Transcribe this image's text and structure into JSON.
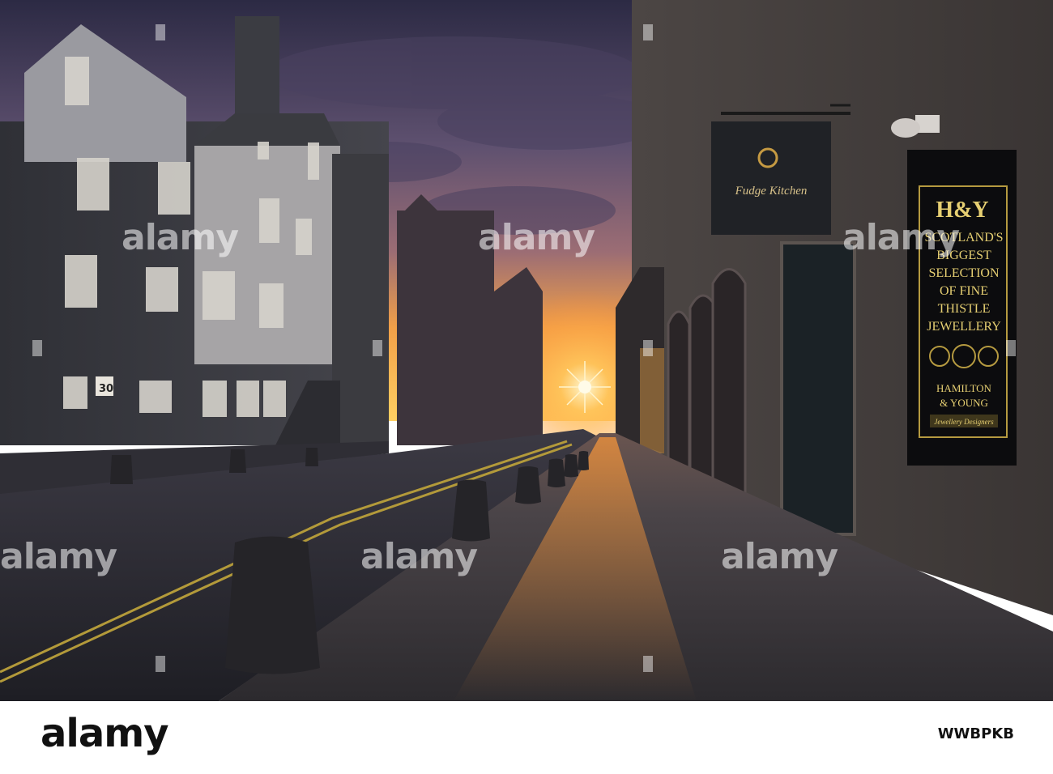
{
  "scene": {
    "sign_shop": {
      "logo_text": "Fudge Kitchen"
    },
    "jewellery_sign": {
      "monogram": "H&Y",
      "lines": [
        "SCOTLAND'S",
        "BIGGEST",
        "SELECTION",
        "OF FINE",
        "THISTLE",
        "JEWELLERY"
      ],
      "brand_line1": "HAMILTON",
      "brand_line2": "& YOUNG",
      "tagline": "Jewellery Designers"
    },
    "window_sign": "30",
    "watermark": "alamy"
  },
  "footer": {
    "logo": "alamy",
    "image_id": "WWBPKB"
  },
  "colors": {
    "sky_top": "#2f2b45",
    "sky_mid": "#6b5674",
    "sunset": "#ffb040",
    "stone": "#3b3b40",
    "pavement": "#4a4547",
    "sign_gold": "#e6cf72"
  }
}
